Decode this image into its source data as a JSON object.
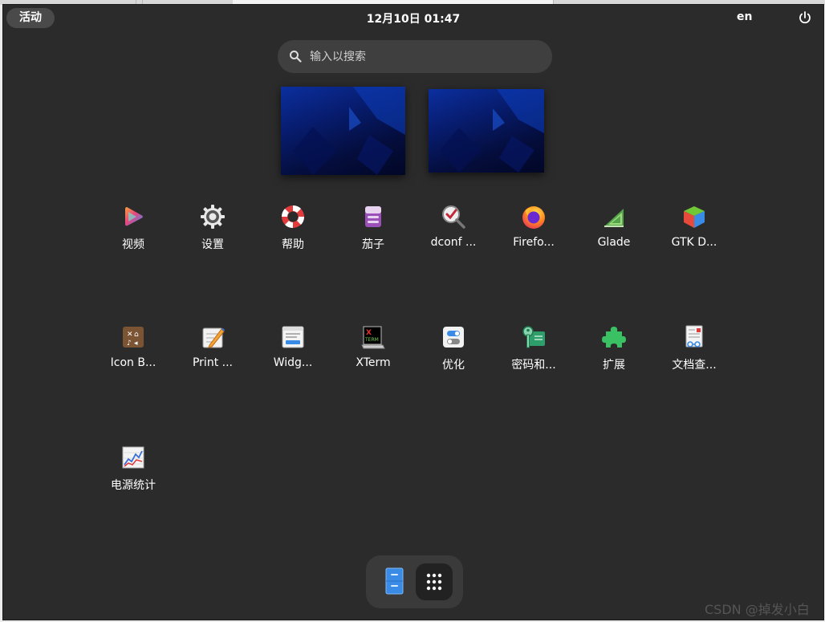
{
  "topbar": {
    "activities_label": "活动",
    "clock": "12月10日  01:47",
    "language": "en",
    "power_icon": "power-icon"
  },
  "search": {
    "placeholder": "输入以搜索",
    "icon": "search-icon"
  },
  "apps": [
    {
      "label": "视频",
      "icon": "video-play-icon"
    },
    {
      "label": "设置",
      "icon": "gear-icon"
    },
    {
      "label": "帮助",
      "icon": "lifebuoy-icon"
    },
    {
      "label": "茄子",
      "icon": "camera-cheese-icon"
    },
    {
      "label": "dconf ...",
      "icon": "dconf-magnifier-icon"
    },
    {
      "label": "Firefo...",
      "icon": "firefox-icon"
    },
    {
      "label": "Glade",
      "icon": "glade-icon"
    },
    {
      "label": "GTK D...",
      "icon": "gtk-cube-icon"
    },
    {
      "label": "Icon B...",
      "icon": "icon-browser-icon"
    },
    {
      "label": "Print ...",
      "icon": "print-editor-icon"
    },
    {
      "label": "Widg...",
      "icon": "widget-factory-icon"
    },
    {
      "label": "XTerm",
      "icon": "xterm-icon"
    },
    {
      "label": "优化",
      "icon": "tweaks-icon"
    },
    {
      "label": "密码和...",
      "icon": "passwords-keys-icon"
    },
    {
      "label": "扩展",
      "icon": "puzzle-piece-icon"
    },
    {
      "label": "文档查...",
      "icon": "document-viewer-icon"
    },
    {
      "label": "电源统计",
      "icon": "power-statistics-icon"
    }
  ],
  "dash": [
    {
      "icon": "file-manager-icon"
    },
    {
      "icon": "app-grid-icon"
    }
  ],
  "watermark": "CSDN @掉发小白"
}
